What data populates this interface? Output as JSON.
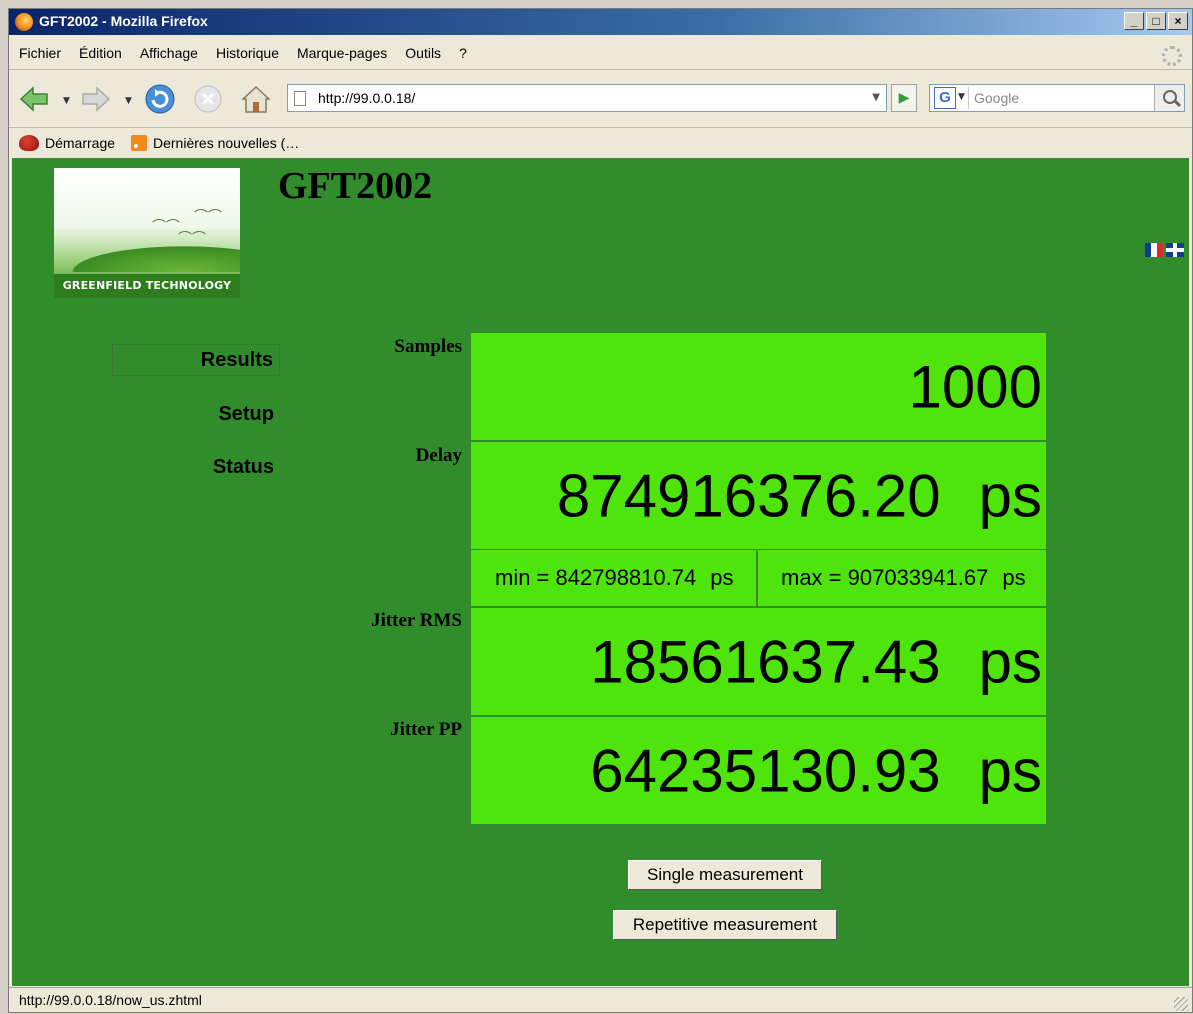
{
  "window": {
    "title": "GFT2002 - Mozilla Firefox"
  },
  "menu": [
    "Fichier",
    "Édition",
    "Affichage",
    "Historique",
    "Marque-pages",
    "Outils",
    "?"
  ],
  "navbar": {
    "url": "http://99.0.0.18/",
    "search_placeholder": "Google"
  },
  "bookmarks": [
    "Démarrage",
    "Dernières nouvelles (…"
  ],
  "page": {
    "title": "GFT2002",
    "logo_text": "GREENFIELD TECHNOLOGY",
    "side_menu": [
      "Results",
      "Setup",
      "Status"
    ],
    "samples": {
      "label": "Samples",
      "value": "1000"
    },
    "delay": {
      "label": "Delay",
      "value": "874916376.20",
      "unit": "ps"
    },
    "min": {
      "text": "min = 842798810.74",
      "unit": "ps"
    },
    "max": {
      "text": "max = 907033941.67",
      "unit": "ps"
    },
    "jitter_rms": {
      "label": "Jitter RMS",
      "value": "18561637.43",
      "unit": "ps"
    },
    "jitter_pp": {
      "label": "Jitter PP",
      "value": "64235130.93",
      "unit": "ps"
    },
    "buttons": {
      "single": "Single measurement",
      "repetitive": "Repetitive measurement"
    }
  },
  "status": {
    "text": "http://99.0.0.18/now_us.zhtml"
  },
  "colors": {
    "page_bg": "#318c2c",
    "value_bg": "#4ee40c"
  }
}
